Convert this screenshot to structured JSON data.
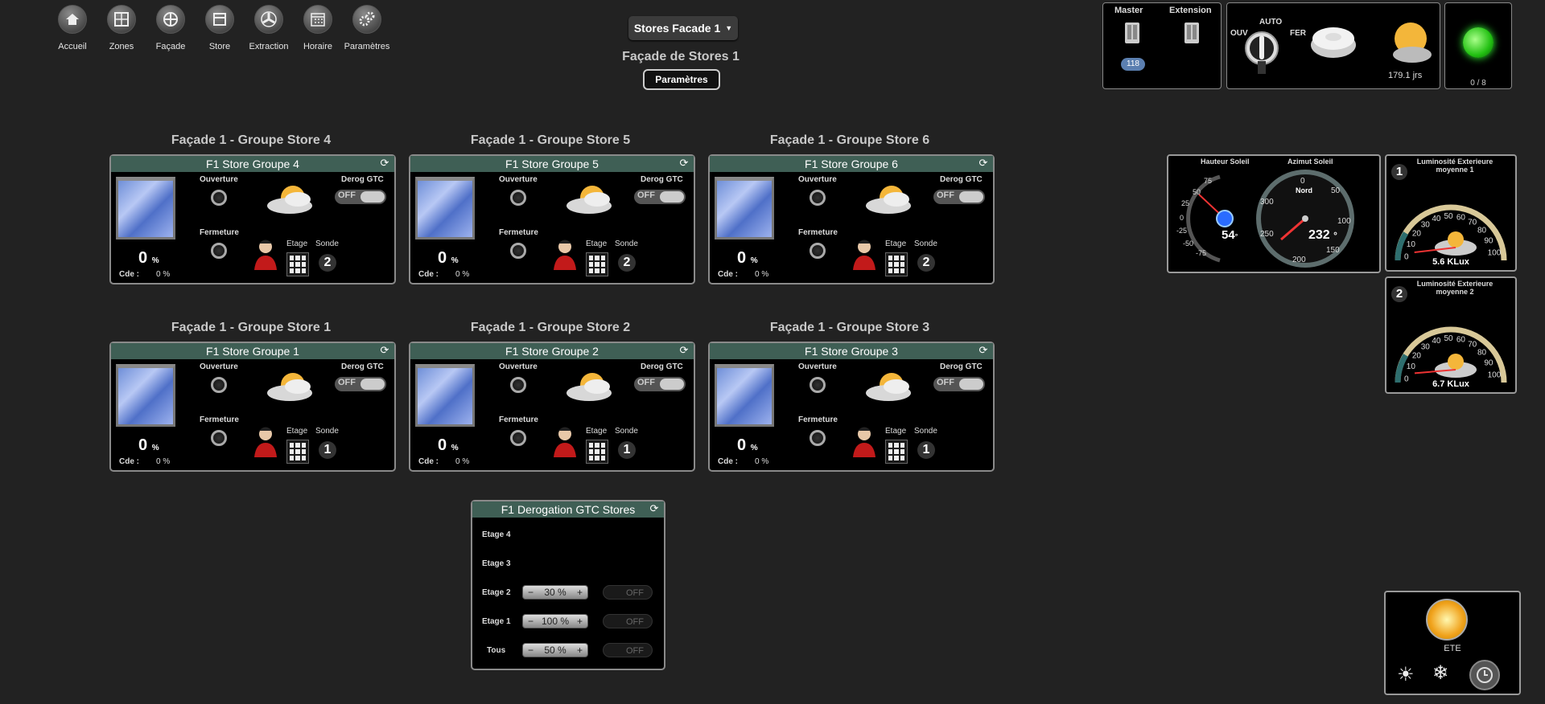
{
  "nav": [
    {
      "label": "Accueil",
      "icon": "home-icon"
    },
    {
      "label": "Zones",
      "icon": "zones-icon"
    },
    {
      "label": "Façade",
      "icon": "facade-icon"
    },
    {
      "label": "Store",
      "icon": "store-icon"
    },
    {
      "label": "Extraction",
      "icon": "fan-icon"
    },
    {
      "label": "Horaire",
      "icon": "calendar-icon"
    },
    {
      "label": "Paramètres",
      "icon": "gears-icon"
    }
  ],
  "header": {
    "dropdown_label": "Stores Facade 1",
    "page_title": "Façade de Stores 1",
    "params_button": "Paramètres"
  },
  "status_panel": {
    "master_label": "Master",
    "extension_label": "Extension",
    "badge": "118",
    "switch_ouv": "OUV",
    "switch_auto": "AUTO",
    "switch_fer": "FER",
    "days": "179.1 jrs",
    "counter": "0 / 8"
  },
  "common": {
    "ouverture": "Ouverture",
    "fermeture": "Fermeture",
    "derog": "Derog GTC",
    "off": "OFF",
    "etage": "Etage",
    "sonde": "Sonde",
    "pct_unit": "%",
    "cde_label": "Cde :"
  },
  "groups": [
    {
      "title": "Façade 1 - Groupe Store 4",
      "head": "F1 Store Groupe 4",
      "percent": "0",
      "cde": "0 %",
      "sonde": "2"
    },
    {
      "title": "Façade 1 - Groupe Store 5",
      "head": "F1 Store Groupe 5",
      "percent": "0",
      "cde": "0 %",
      "sonde": "2"
    },
    {
      "title": "Façade 1 - Groupe Store 6",
      "head": "F1 Store Groupe 6",
      "percent": "0",
      "cde": "0 %",
      "sonde": "2"
    },
    {
      "title": "Façade 1 - Groupe Store 1",
      "head": "F1 Store Groupe 1",
      "percent": "0",
      "cde": "0 %",
      "sonde": "1"
    },
    {
      "title": "Façade 1 - Groupe Store 2",
      "head": "F1 Store Groupe 2",
      "percent": "0",
      "cde": "0 %",
      "sonde": "1"
    },
    {
      "title": "Façade 1 - Groupe Store 3",
      "head": "F1 Store Groupe 3",
      "percent": "0",
      "cde": "0 %",
      "sonde": "1"
    }
  ],
  "derogation": {
    "head": "F1 Derogation GTC Stores",
    "rows": [
      {
        "label": "Etage 4"
      },
      {
        "label": "Etage 3"
      },
      {
        "label": "Etage 2",
        "value": "30 %",
        "off": "OFF"
      },
      {
        "label": "Etage 1",
        "value": "100 %",
        "off": "OFF"
      },
      {
        "label": "Tous",
        "value": "50 %",
        "off": "OFF"
      }
    ],
    "minus": "−",
    "plus": "+"
  },
  "sun": {
    "hauteur_label": "Hauteur Soleil",
    "azimut_label": "Azimut Soleil",
    "hauteur_value": "54",
    "hauteur_unit": "°",
    "azimut_value": "232",
    "azimut_unit": "°",
    "azimut_north": "Nord",
    "hauteur_ticks": [
      "75",
      "50",
      "25",
      "0",
      "-25",
      "-50",
      "-75"
    ],
    "azimut_ticks": [
      "0",
      "50",
      "100",
      "150",
      "200",
      "250",
      "300"
    ]
  },
  "lux": [
    {
      "title": "Luminosité Exterieure moyenne 1",
      "badge": "1",
      "value": "5.6 KLux",
      "level": 5.6,
      "ticks": [
        "0",
        "10",
        "20",
        "30",
        "40",
        "50",
        "60",
        "70",
        "80",
        "90",
        "100"
      ]
    },
    {
      "title": "Luminosité Exterieure moyenne 2",
      "badge": "2",
      "value": "6.7 KLux",
      "level": 6.7,
      "ticks": [
        "0",
        "10",
        "20",
        "30",
        "40",
        "50",
        "60",
        "70",
        "80",
        "90",
        "100"
      ]
    }
  ],
  "season": {
    "label": "ETE"
  }
}
